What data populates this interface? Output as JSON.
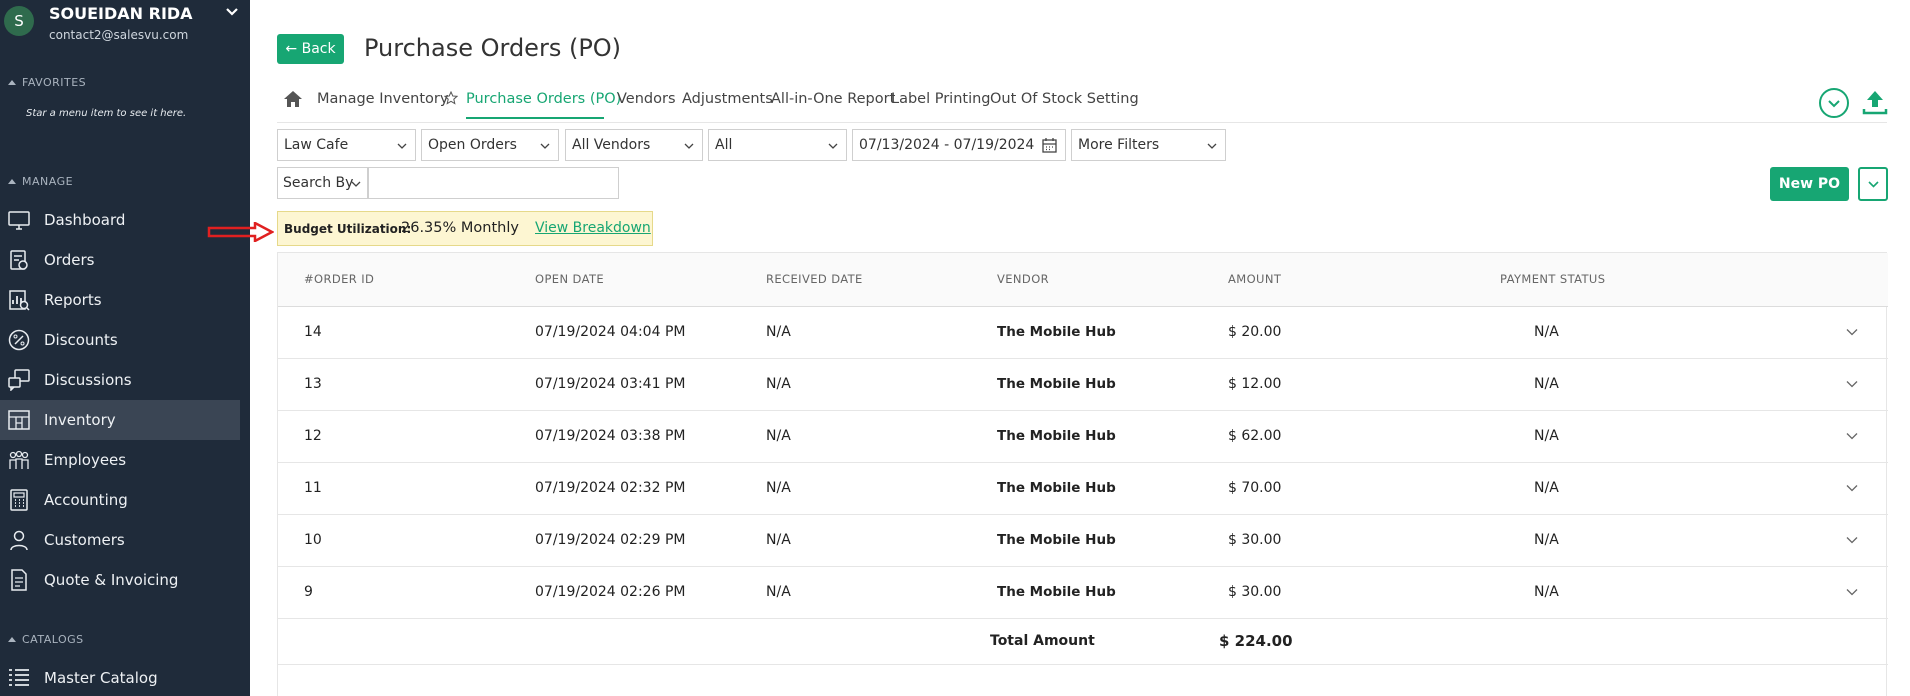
{
  "user": {
    "initial": "S",
    "name": "SOUEIDAN RIDA",
    "email": "contact2@salesvu.com"
  },
  "sidebar": {
    "favorites_header": "FAVORITES",
    "favorites_hint": "Star a menu item to see it here.",
    "manage_header": "MANAGE",
    "items": [
      {
        "label": "Dashboard",
        "icon": "monitor-icon"
      },
      {
        "label": "Orders",
        "icon": "orders-icon"
      },
      {
        "label": "Reports",
        "icon": "reports-icon"
      },
      {
        "label": "Discounts",
        "icon": "percent-icon"
      },
      {
        "label": "Discussions",
        "icon": "discussion-icon"
      },
      {
        "label": "Inventory",
        "icon": "inventory-icon",
        "active": true
      },
      {
        "label": "Employees",
        "icon": "employees-icon"
      },
      {
        "label": "Accounting",
        "icon": "calculator-icon"
      },
      {
        "label": "Customers",
        "icon": "customer-icon"
      },
      {
        "label": "Quote & Invoicing",
        "icon": "invoice-icon"
      }
    ],
    "catalogs_header": "CATALOGS",
    "catalog_items": [
      {
        "label": "Master Catalog",
        "icon": "catalog-icon"
      }
    ]
  },
  "header": {
    "back_label": "Back",
    "title": "Purchase Orders (PO)"
  },
  "tabs": [
    {
      "label": "Manage Inventory"
    },
    {
      "label": "Purchase Orders (PO)",
      "active": true
    },
    {
      "label": "Vendors"
    },
    {
      "label": "Adjustments"
    },
    {
      "label": "All-in-One Report"
    },
    {
      "label": "Label Printing"
    },
    {
      "label": "Out Of Stock Setting"
    }
  ],
  "filters": {
    "location": "Law Cafe",
    "status": "Open Orders",
    "vendor": "All Vendors",
    "type": "All",
    "date_range": "07/13/2024 - 07/19/2024",
    "more": "More Filters",
    "search_by": "Search By",
    "search_value": ""
  },
  "actions": {
    "new_po": "New PO"
  },
  "budget": {
    "label": "Budget Utilization:",
    "value": "26.35% Monthly",
    "link": "View Breakdown"
  },
  "table": {
    "headers": [
      "#ORDER ID",
      "OPEN DATE",
      "RECEIVED DATE",
      "VENDOR",
      "AMOUNT",
      "PAYMENT STATUS"
    ],
    "rows": [
      {
        "id": "14",
        "open_date": "07/19/2024 04:04 PM",
        "received": "N/A",
        "vendor": "The Mobile Hub",
        "amount": "$ 20.00",
        "payment": "N/A"
      },
      {
        "id": "13",
        "open_date": "07/19/2024 03:41 PM",
        "received": "N/A",
        "vendor": "The Mobile Hub",
        "amount": "$ 12.00",
        "payment": "N/A"
      },
      {
        "id": "12",
        "open_date": "07/19/2024 03:38 PM",
        "received": "N/A",
        "vendor": "The Mobile Hub",
        "amount": "$ 62.00",
        "payment": "N/A"
      },
      {
        "id": "11",
        "open_date": "07/19/2024 02:32 PM",
        "received": "N/A",
        "vendor": "The Mobile Hub",
        "amount": "$ 70.00",
        "payment": "N/A"
      },
      {
        "id": "10",
        "open_date": "07/19/2024 02:29 PM",
        "received": "N/A",
        "vendor": "The Mobile Hub",
        "amount": "$ 30.00",
        "payment": "N/A"
      },
      {
        "id": "9",
        "open_date": "07/19/2024 02:26 PM",
        "received": "N/A",
        "vendor": "The Mobile Hub",
        "amount": "$ 30.00",
        "payment": "N/A"
      }
    ],
    "total_label": "Total Amount",
    "total_value": "$ 224.00"
  },
  "colors": {
    "accent": "#17a673",
    "sidebar_bg": "#1f2b3a",
    "sidebar_active": "#3a4554",
    "budget_bg": "#fdf6d2",
    "arrow": "#e02020"
  }
}
